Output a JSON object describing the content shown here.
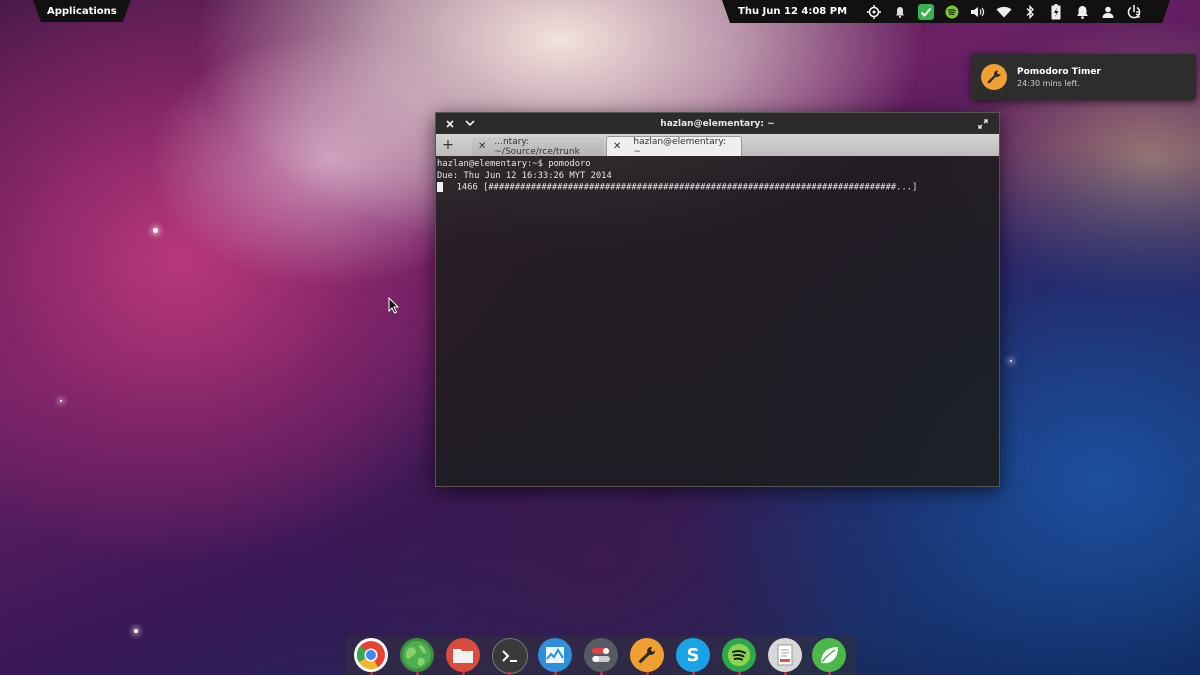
{
  "panel": {
    "applications_label": "Applications",
    "clock": "Thu Jun 12  4:08 PM",
    "indicators": [
      "location-icon",
      "bell-icon",
      "check-shield-icon",
      "spotify-icon",
      "volume-icon",
      "wifi-icon",
      "bluetooth-icon",
      "battery-icon",
      "notification-icon",
      "user-icon",
      "power-icon"
    ]
  },
  "notification": {
    "title": "Pomodoro Timer",
    "body": "24:30 mins left.",
    "icon": "wrench-icon",
    "accent": "#f0a030"
  },
  "terminal": {
    "title": "hazlan@elementary: ~",
    "tabs": [
      {
        "label": "...ntary: ~/Source/rce/trunk",
        "active": false
      },
      {
        "label": "hazlan@elementary: ~",
        "active": true
      }
    ],
    "lines": [
      "hazlan@elementary:~$ pomodoro",
      "Due: Thu Jun 12 16:33:26 MYT 2014",
      "  1466 [#############################################################################...]"
    ]
  },
  "dock": {
    "items": [
      {
        "name": "chrome",
        "color": "#e94235"
      },
      {
        "name": "web-browser",
        "color": "#4caf50"
      },
      {
        "name": "files",
        "color": "#e05540"
      },
      {
        "name": "terminal",
        "color": "#3a3a3a"
      },
      {
        "name": "system-monitor",
        "color": "#2f8fd8"
      },
      {
        "name": "settings",
        "color": "#555a63"
      },
      {
        "name": "pomodoro",
        "color": "#f0a030"
      },
      {
        "name": "skype",
        "color": "#1aa3e8"
      },
      {
        "name": "spotify",
        "color": "#2ea84f"
      },
      {
        "name": "text-editor",
        "color": "#d8d8d8"
      },
      {
        "name": "leaf-app",
        "color": "#4cb84a"
      }
    ]
  }
}
